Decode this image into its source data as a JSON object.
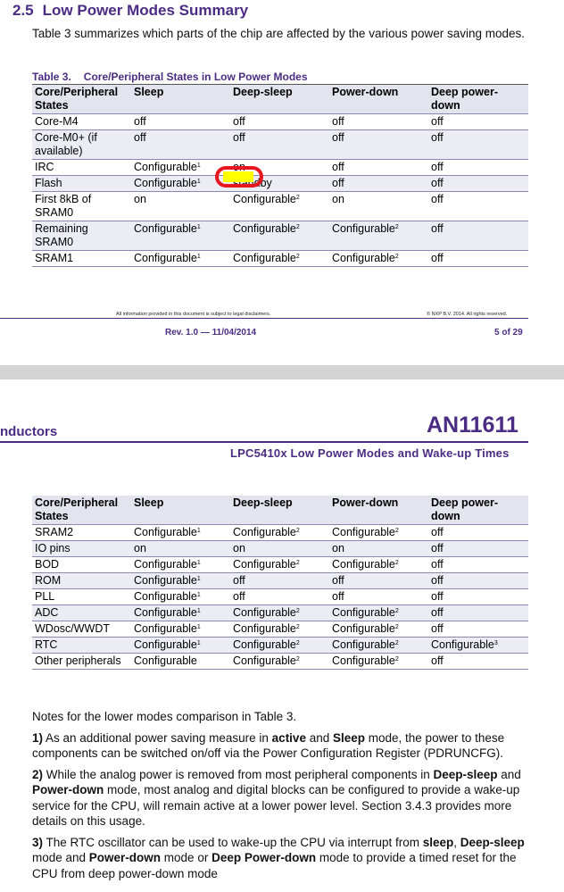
{
  "section": {
    "number": "2.5",
    "title": "Low Power Modes Summary"
  },
  "intro": "Table 3 summarizes which parts of the chip are affected by the various power saving modes.",
  "table_caption": {
    "label": "Table 3.",
    "title": "Core/Peripheral States in Low Power Modes"
  },
  "table_headers": [
    "Core/Peripheral States",
    "Sleep",
    "Deep-sleep",
    "Power-down",
    "Deep power-down"
  ],
  "table1_rows": [
    [
      {
        "t": "Core-M4"
      },
      {
        "t": "off"
      },
      {
        "t": "off"
      },
      {
        "t": "off"
      },
      {
        "t": "off"
      }
    ],
    [
      {
        "t": "Core-M0+ (if available)"
      },
      {
        "t": "off"
      },
      {
        "t": "off"
      },
      {
        "t": "off"
      },
      {
        "t": "off"
      }
    ],
    [
      {
        "t": "IRC"
      },
      {
        "t": "Configurable",
        "s": "1"
      },
      {
        "t": "on"
      },
      {
        "t": "off"
      },
      {
        "t": "off"
      }
    ],
    [
      {
        "t": "Flash"
      },
      {
        "t": "Configurable",
        "s": "1"
      },
      {
        "t": "standby"
      },
      {
        "t": "off"
      },
      {
        "t": "off"
      }
    ],
    [
      {
        "t": "First 8kB of SRAM0"
      },
      {
        "t": "on"
      },
      {
        "t": "Configurable",
        "s": "2"
      },
      {
        "t": "on"
      },
      {
        "t": "off"
      }
    ],
    [
      {
        "t": "Remaining SRAM0"
      },
      {
        "t": "Configurable",
        "s": "1"
      },
      {
        "t": "Configurable",
        "s": "2"
      },
      {
        "t": "Configurable",
        "s": "2"
      },
      {
        "t": "off"
      }
    ],
    [
      {
        "t": "SRAM1"
      },
      {
        "t": "Configurable",
        "s": "1"
      },
      {
        "t": "Configurable",
        "s": "2"
      },
      {
        "t": "Configurable",
        "s": "2"
      },
      {
        "t": "off"
      }
    ]
  ],
  "footer": {
    "disclaimer": "All information provided in this document is subject to legal disclaimers.",
    "copyright": "© NXP B.V. 2014. All rights reserved.",
    "revision": "Rev. 1.0 — 11/04/2014",
    "page": "5 of 29"
  },
  "header": {
    "company": "nductors",
    "doc_id": "AN11611",
    "doc_title": "LPC5410x Low Power Modes and Wake-up Times"
  },
  "table2_rows": [
    [
      {
        "t": "SRAM2"
      },
      {
        "t": "Configurable",
        "s": "1"
      },
      {
        "t": "Configurable",
        "s": "2"
      },
      {
        "t": "Configurable",
        "s": "2"
      },
      {
        "t": "off"
      }
    ],
    [
      {
        "t": "IO pins"
      },
      {
        "t": "on"
      },
      {
        "t": "on"
      },
      {
        "t": "on"
      },
      {
        "t": "off"
      }
    ],
    [
      {
        "t": "BOD"
      },
      {
        "t": "Configurable",
        "s": "1"
      },
      {
        "t": "Configurable",
        "s": "2"
      },
      {
        "t": "Configurable",
        "s": "2"
      },
      {
        "t": "off"
      }
    ],
    [
      {
        "t": "ROM"
      },
      {
        "t": "Configurable",
        "s": "1"
      },
      {
        "t": "off"
      },
      {
        "t": "off"
      },
      {
        "t": "off"
      }
    ],
    [
      {
        "t": "PLL"
      },
      {
        "t": "Configurable",
        "s": "1"
      },
      {
        "t": "off"
      },
      {
        "t": "off"
      },
      {
        "t": "off"
      }
    ],
    [
      {
        "t": "ADC"
      },
      {
        "t": "Configurable",
        "s": "1"
      },
      {
        "t": "Configurable",
        "s": "2"
      },
      {
        "t": "Configurable",
        "s": "2"
      },
      {
        "t": "off"
      }
    ],
    [
      {
        "t": "WDosc/WWDT"
      },
      {
        "t": "Configurable",
        "s": "1"
      },
      {
        "t": "Configurable",
        "s": "2"
      },
      {
        "t": "Configurable",
        "s": "2"
      },
      {
        "t": "off"
      }
    ],
    [
      {
        "t": "RTC"
      },
      {
        "t": "Configurable",
        "s": "1"
      },
      {
        "t": "Configurable",
        "s": "2"
      },
      {
        "t": "Configurable",
        "s": "2"
      },
      {
        "t": "Configurable",
        "s": "3"
      }
    ],
    [
      {
        "t": "Other peripherals"
      },
      {
        "t": "Configurable"
      },
      {
        "t": "Configurable",
        "s": "2"
      },
      {
        "t": "Configurable",
        "s": "2"
      },
      {
        "t": "off"
      }
    ]
  ],
  "notes_intro": "Notes for the lower modes comparison in Table 3.",
  "notes": [
    [
      {
        "t": "1)",
        "b": true
      },
      {
        "t": " As an additional power saving measure in "
      },
      {
        "t": "active",
        "b": true
      },
      {
        "t": " and "
      },
      {
        "t": "Sleep",
        "b": true
      },
      {
        "t": " mode, the power to these components can be switched on/off via the Power Configuration Register (PDRUNCFG)."
      }
    ],
    [
      {
        "t": "2)",
        "b": true
      },
      {
        "t": " While the analog power is removed from most peripheral components in "
      },
      {
        "t": "Deep-sleep",
        "b": true
      },
      {
        "t": " and "
      },
      {
        "t": "Power-down",
        "b": true
      },
      {
        "t": " mode, most analog and digital blocks can be configured to provide a wake-up service for the CPU, will remain active at a lower power level. Section 3.4.3 provides more details on this usage."
      }
    ],
    [
      {
        "t": "3)",
        "b": true
      },
      {
        "t": " The RTC oscillator can be used to wake-up the CPU via interrupt from "
      },
      {
        "t": "sleep",
        "b": true
      },
      {
        "t": ", "
      },
      {
        "t": "Deep-sleep",
        "b": true
      },
      {
        "t": " mode and "
      },
      {
        "t": "Power-down",
        "b": true
      },
      {
        "t": " mode or "
      },
      {
        "t": "Deep Power-down",
        "b": true
      },
      {
        "t": " mode to provide a timed reset for the CPU from deep power-down mode"
      }
    ]
  ],
  "highlight": {
    "color": "#ffff00",
    "circle_color": "#e8171f"
  }
}
